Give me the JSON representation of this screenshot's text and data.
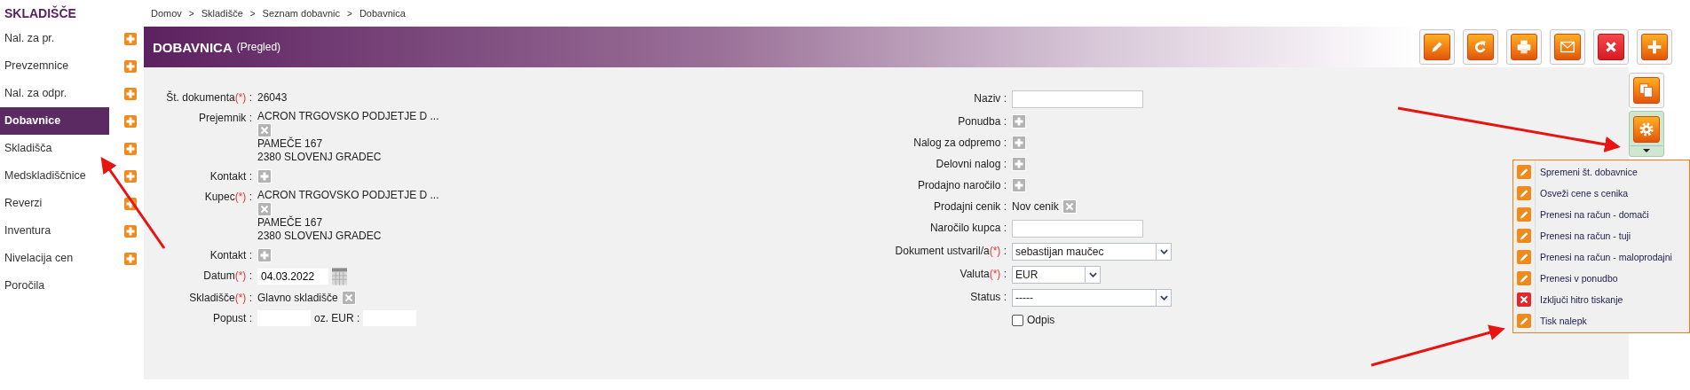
{
  "sidebar": {
    "title": "SKLADIŠČE",
    "items": [
      {
        "label": "Nal. za pr.",
        "selected": false,
        "add_button": true
      },
      {
        "label": "Prevzemnice",
        "selected": false,
        "add_button": true
      },
      {
        "label": "Nal. za odpr.",
        "selected": false,
        "add_button": true
      },
      {
        "label": "Dobavnice",
        "selected": true,
        "add_button": true
      },
      {
        "label": "Skladišča",
        "selected": false,
        "add_button": true
      },
      {
        "label": "Medskladiščnice",
        "selected": false,
        "add_button": true
      },
      {
        "label": "Reverzi",
        "selected": false,
        "add_button": true
      },
      {
        "label": "Inventura",
        "selected": false,
        "add_button": true
      },
      {
        "label": "Nivelacija cen",
        "selected": false,
        "add_button": true
      },
      {
        "label": "Poročila",
        "selected": false,
        "add_button": false
      }
    ]
  },
  "breadcrumb": {
    "separator": ">",
    "items": [
      "Domov",
      "Skladišče",
      "Seznam dobavnic",
      "Dobavnica"
    ]
  },
  "header": {
    "title": "DOBAVNICA",
    "subtitle": "(Pregled)"
  },
  "toolbar": [
    {
      "kind": "edit"
    },
    {
      "kind": "refresh"
    },
    {
      "kind": "print"
    },
    {
      "kind": "mail"
    },
    {
      "kind": "delete"
    },
    {
      "kind": "add"
    }
  ],
  "side_buttons": [
    {
      "kind": "copy",
      "active": false,
      "dropdown": false
    },
    {
      "kind": "settings",
      "active": true,
      "dropdown": true
    }
  ],
  "form": {
    "separator": ":",
    "left": [
      {
        "kind": "text",
        "label": "Št. dokumenta",
        "required_mark": "(*)",
        "value": "26043"
      },
      {
        "kind": "party",
        "label": "Prejemnik",
        "name": "ACRON TRGOVSKO PODJETJE D ...",
        "address": [
          "PAMEČE 167",
          "2380 SLOVENJ GRADEC"
        ]
      },
      {
        "kind": "add",
        "label": "Kontakt"
      },
      {
        "kind": "party",
        "label": "Kupec",
        "required_mark": "(*)",
        "name": "ACRON TRGOVSKO PODJETJE D ...",
        "address": [
          "PAMEČE 167",
          "2380 SLOVENJ GRADEC"
        ]
      },
      {
        "kind": "add",
        "label": "Kontakt"
      },
      {
        "kind": "date",
        "label": "Datum",
        "required_mark": "(*)",
        "value": "04.03.2022"
      },
      {
        "kind": "removable",
        "label": "Skladišče",
        "required_mark": "(*)",
        "value": "Glavno skladišče"
      },
      {
        "kind": "discount",
        "label": "Popust",
        "between_label": "oz. EUR :"
      }
    ],
    "right": [
      {
        "kind": "input",
        "label": "Naziv"
      },
      {
        "kind": "add",
        "label": "Ponudba"
      },
      {
        "kind": "add",
        "label": "Nalog za odpremo"
      },
      {
        "kind": "add",
        "label": "Delovni nalog"
      },
      {
        "kind": "add",
        "label": "Prodajno naročilo"
      },
      {
        "kind": "removable",
        "label": "Prodajni cenik",
        "value": "Nov cenik"
      },
      {
        "kind": "input",
        "label": "Naročilo kupca"
      },
      {
        "kind": "select",
        "label": "Dokument ustvaril/a",
        "required_mark": "(*)",
        "value": "sebastijan maučec"
      },
      {
        "kind": "currency",
        "label": "Valuta",
        "required_mark": "(*)",
        "value": "EUR"
      },
      {
        "kind": "select",
        "label": "Status",
        "value": "-----"
      },
      {
        "kind": "checkbox",
        "text": "Odpis",
        "checked": false
      }
    ]
  },
  "menu": [
    {
      "label": "Spremeni št. dobavnice",
      "kind": "edit"
    },
    {
      "label": "Osveži cene s cenika",
      "kind": "edit"
    },
    {
      "label": "Prenesi na račun - domači",
      "kind": "edit"
    },
    {
      "label": "Prenesi na račun - tuji",
      "kind": "edit"
    },
    {
      "label": "Prenesi na račun - maloprodajni",
      "kind": "edit"
    },
    {
      "label": "Prenesi v ponudbo",
      "kind": "edit"
    },
    {
      "label": "Izključi hitro tiskanje",
      "kind": "delete"
    },
    {
      "label": "Tisk nalepk",
      "kind": "edit"
    }
  ]
}
